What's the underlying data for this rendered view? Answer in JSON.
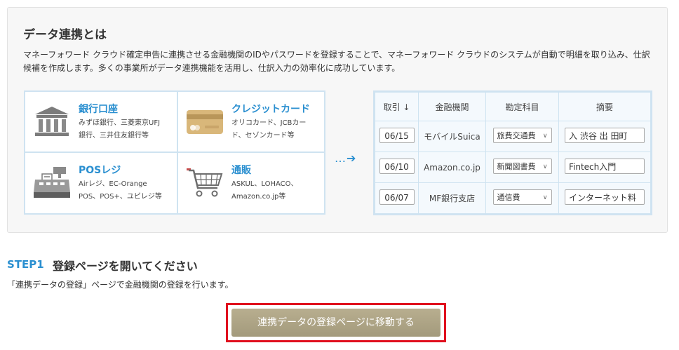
{
  "intro": {
    "title": "データ連携とは",
    "description": "マネーフォワード クラウド確定申告に連携させる金融機関のIDやパスワードを登録することで、マネーフォワード クラウドのシステムが自動で明細を取り込み、仕訳候補を作成します。多くの事業所がデータ連携機能を活用し、仕訳入力の効率化に成功しています。"
  },
  "services": [
    {
      "title": "銀行口座",
      "line1": "みずほ銀行、三菱東京UFJ",
      "line2": "銀行、三井住友銀行等",
      "icon": "bank-icon"
    },
    {
      "title": "クレジットカード",
      "line1": "オリコカード、JCBカー",
      "line2": "ド、セゾンカード等",
      "icon": "credit-card-icon"
    },
    {
      "title": "POSレジ",
      "line1": "Airレジ、EC-Orange",
      "line2": "POS、POS+、ユビレジ等",
      "icon": "pos-register-icon"
    },
    {
      "title": "通販",
      "line1": "ASKUL、LOHACO、",
      "line2": "Amazon.co.jp等",
      "icon": "shopping-cart-icon"
    }
  ],
  "arrow": "…➔",
  "ledger": {
    "headers": {
      "date": "取引 ↓",
      "institution": "金融機関",
      "account": "勘定科目",
      "memo": "摘要"
    },
    "rows": [
      {
        "date": "06/15",
        "institution": "モバイルSuica",
        "account": "旅費交通費",
        "memo": "入 渋谷 出 田町"
      },
      {
        "date": "06/10",
        "institution": "Amazon.co.jp",
        "account": "新聞図書費",
        "memo": "Fintech入門"
      },
      {
        "date": "06/07",
        "institution": "MF銀行支店",
        "account": "通信費",
        "memo": "インターネット料"
      }
    ]
  },
  "step": {
    "label": "STEP1",
    "title": "登録ページを開いてください",
    "description": "「連携データの登録」ページで金融機関の登録を行います。",
    "button_label": "連携データの登録ページに移動する"
  },
  "colors": {
    "accent": "#2a8fd0",
    "border": "#cfe3f1",
    "button": "#a39a7c",
    "highlight": "#e0101e"
  }
}
